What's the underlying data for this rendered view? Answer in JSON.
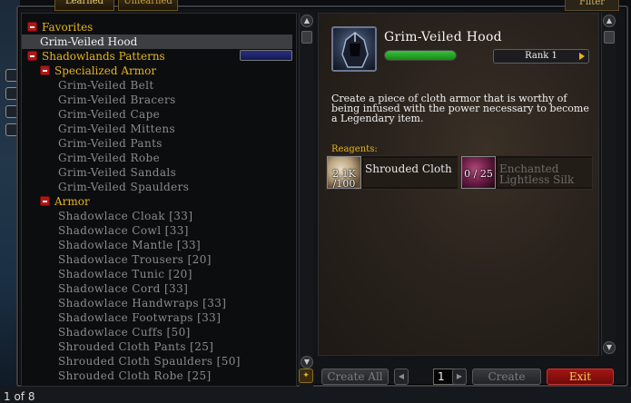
{
  "tabs": {
    "learned": "Learned",
    "unlearned": "Unlearned",
    "filter": "Filter"
  },
  "recipe_list": [
    {
      "text": "Favorites",
      "kind": "header"
    },
    {
      "text": "Grim-Veiled Hood",
      "kind": "selected"
    },
    {
      "text": "Shadowlands Patterns",
      "kind": "header"
    },
    {
      "text": "Specialized Armor",
      "kind": "sub"
    },
    {
      "text": "Grim-Veiled Belt",
      "kind": "recipe"
    },
    {
      "text": "Grim-Veiled Bracers",
      "kind": "recipe"
    },
    {
      "text": "Grim-Veiled Cape",
      "kind": "recipe"
    },
    {
      "text": "Grim-Veiled Mittens",
      "kind": "recipe"
    },
    {
      "text": "Grim-Veiled Pants",
      "kind": "recipe"
    },
    {
      "text": "Grim-Veiled Robe",
      "kind": "recipe"
    },
    {
      "text": "Grim-Veiled Sandals",
      "kind": "recipe"
    },
    {
      "text": "Grim-Veiled Spaulders",
      "kind": "recipe"
    },
    {
      "text": "Armor",
      "kind": "sub"
    },
    {
      "text": "Shadowlace Cloak [33]",
      "kind": "recipe"
    },
    {
      "text": "Shadowlace Cowl [33]",
      "kind": "recipe"
    },
    {
      "text": "Shadowlace Mantle [33]",
      "kind": "recipe"
    },
    {
      "text": "Shadowlace Trousers [20]",
      "kind": "recipe"
    },
    {
      "text": "Shadowlace Tunic [20]",
      "kind": "recipe"
    },
    {
      "text": "Shadowlace Cord [33]",
      "kind": "recipe"
    },
    {
      "text": "Shadowlace Handwraps [33]",
      "kind": "recipe"
    },
    {
      "text": "Shadowlace Footwraps [33]",
      "kind": "recipe"
    },
    {
      "text": "Shadowlace Cuffs [50]",
      "kind": "recipe"
    },
    {
      "text": "Shrouded Cloth Pants [25]",
      "kind": "recipe"
    },
    {
      "text": "Shrouded Cloth Spaulders [50]",
      "kind": "recipe"
    },
    {
      "text": "Shrouded Cloth Robe [25]",
      "kind": "recipe"
    }
  ],
  "detail": {
    "title": "Grim-Veiled Hood",
    "rank": "Rank 1",
    "description": "Create a piece of cloth armor that is worthy of being infused with the power necessary to become a Legendary item.",
    "reagents_label": "Reagents:",
    "reagents": [
      {
        "count": "2.1K /100",
        "name": "Shrouded Cloth",
        "missing": false
      },
      {
        "count": "0 / 25",
        "name": "Enchanted Lightless Silk",
        "missing": true
      }
    ]
  },
  "controls": {
    "create_all": "Create All",
    "quantity": "1",
    "create": "Create",
    "exit": "Exit"
  },
  "footer": {
    "page_count": "1 of 8"
  },
  "colors": {
    "gold": "#e6b31c",
    "exit_red": "#a51414",
    "skill_green": "#3dc03d"
  },
  "icons": [
    "collapse-minus-icon",
    "scroll-up-icon",
    "scroll-down-icon",
    "hood-icon",
    "cloth-icon",
    "silk-icon",
    "arrow-left-icon",
    "arrow-right-icon"
  ]
}
